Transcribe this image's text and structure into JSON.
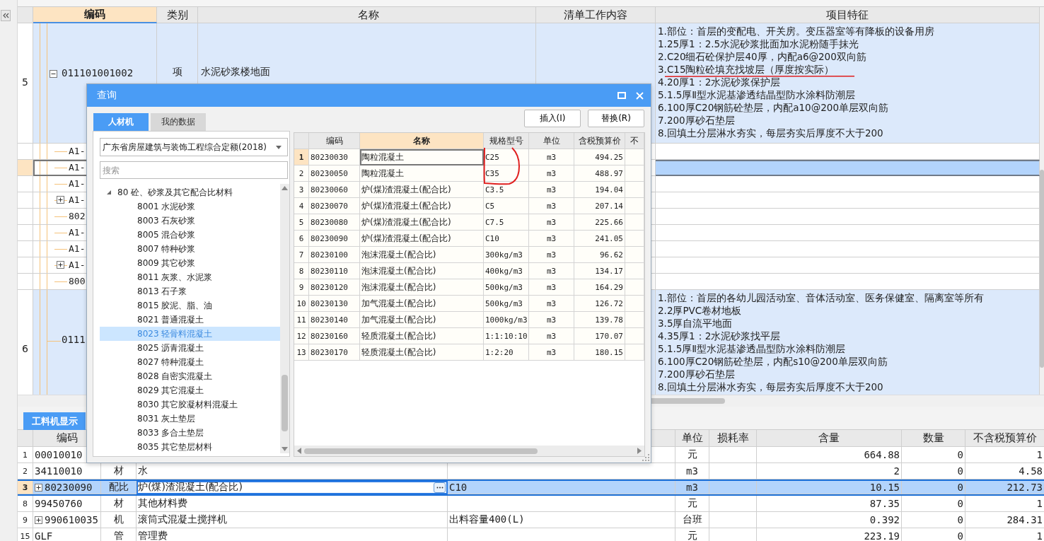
{
  "grid": {
    "columns": [
      "编码",
      "类别",
      "名称",
      "清单工作内容",
      "项目特征"
    ],
    "rows": [
      {
        "kind": "item",
        "num": "5",
        "code": "011101001002",
        "expanded": true,
        "type": "项",
        "name": "水泥砂浆楼地面",
        "features": [
          "1.部位：首层的变配电、开关房。变压器室等有降板的设备用房",
          "1.25厚1：2.5水泥砂浆批面加水泥粉随手抹光",
          "2.C20细石砼保护层40厚，内配a6@200双向筋",
          "3.C15陶粒砼填充找坡层（厚度按实际）",
          "4.20厚1：2水泥砂浆保护层",
          "5.1.5厚Ⅱ型水泥基渗透结晶型防水涂料防潮层",
          "6.100厚C20钢筋砼垫层，内配a10@200单层双向筋",
          "7.200厚砂石垫层",
          "8.回填土分层淋水夯实，每层夯实后厚度不大于200"
        ]
      },
      {
        "kind": "sub",
        "code": "A1-",
        "selected": false
      },
      {
        "kind": "sub",
        "code": "A1-",
        "selected": true
      },
      {
        "kind": "sub",
        "code": "A1-",
        "selected": false
      },
      {
        "kind": "sub",
        "code": "A1-",
        "expanded": false,
        "selected": false
      },
      {
        "kind": "sub",
        "code": "802",
        "selected": false
      },
      {
        "kind": "sub",
        "code": "A1-",
        "selected": false
      },
      {
        "kind": "sub",
        "code": "A1-",
        "selected": false
      },
      {
        "kind": "sub",
        "code": "A1-",
        "expanded": false,
        "selected": false
      },
      {
        "kind": "sub",
        "code": "800",
        "selected": false
      },
      {
        "kind": "item",
        "num": "6",
        "code": "0111",
        "features": [
          "1.部位：首层的各幼儿园活动室、音体活动室、医务保健室、隔离室等所有",
          "2.2厚PVC卷材地板",
          "3.5厚自流平地面",
          "4.35厚1：2水泥砂浆找平层",
          "5.1.5厚Ⅱ型水泥基渗透晶型防水涂料防潮层",
          "6.100厚C20钢筋砼垫层，内配s10@200单层双向筋",
          "7.200厚砂石垫层",
          "8.回填土分层淋水夯实，每层夯实后厚度不大于200"
        ]
      }
    ]
  },
  "materials": {
    "tab": "工料机显示",
    "columns": {
      "code": "编码",
      "unit": "单位",
      "loss": "损耗率",
      "content": "含量",
      "qty": "数量",
      "price": "不含税预算价"
    },
    "rows": [
      {
        "num": "1",
        "code": "00010010",
        "unit": "元",
        "content": "664.88",
        "qty": "0",
        "price": "1",
        "selected": false
      },
      {
        "num": "2",
        "code": "34110010",
        "type": "材",
        "name": "水",
        "unit": "m3",
        "content": "2",
        "qty": "0",
        "price": "4.58",
        "selected": false
      },
      {
        "num": "3",
        "code": "80230090",
        "expanded": false,
        "type": "配比",
        "name": "炉(煤)渣混凝土(配合比)",
        "spec": "C10",
        "unit": "m3",
        "content": "10.15",
        "qty": "0",
        "price": "212.73",
        "selected": true
      },
      {
        "num": "8",
        "code": "99450760",
        "type": "材",
        "name": "其他材料费",
        "unit": "元",
        "content": "87.35",
        "qty": "0",
        "price": "1",
        "selected": false
      },
      {
        "num": "9",
        "code": "990610035",
        "expanded": false,
        "type": "机",
        "name": "滚筒式混凝土搅拌机",
        "spec": "出料容量400(L)",
        "unit": "台班",
        "content": "0.392",
        "qty": "0",
        "price": "284.31",
        "selected": false
      },
      {
        "num": "15",
        "code": "GLF",
        "type": "管",
        "name": "管理费",
        "unit": "元",
        "content": "223.19",
        "qty": "0",
        "price": "1",
        "selected": false
      }
    ]
  },
  "dialog": {
    "title": "查询",
    "tabs": [
      {
        "label": "人材机",
        "selected": true
      },
      {
        "label": "我的数据",
        "selected": false
      }
    ],
    "buttons": [
      "插入(I)",
      "替换(R)"
    ],
    "library": "广东省房屋建筑与装饰工程综合定额(2018)",
    "search": {
      "placeholder": "搜索"
    },
    "tree": [
      {
        "label": "80 砼、砂浆及其它配合比材料",
        "expanded": true,
        "children": [
          {
            "label": "8001 水泥砂浆",
            "selected": false
          },
          {
            "label": "8003 石灰砂浆",
            "selected": false
          },
          {
            "label": "8005 混合砂浆",
            "selected": false
          },
          {
            "label": "8007 特种砂浆",
            "selected": false
          },
          {
            "label": "8009 其它砂浆",
            "selected": false
          },
          {
            "label": "8011 灰浆、水泥浆",
            "selected": false
          },
          {
            "label": "8013 石子浆",
            "selected": false
          },
          {
            "label": "8015 胶泥、脂、油",
            "selected": false
          },
          {
            "label": "8021 普通混凝土",
            "selected": false
          },
          {
            "label": "8023 轻骨料混凝土",
            "selected": true
          },
          {
            "label": "8025 沥青混凝土",
            "selected": false
          },
          {
            "label": "8027 特种混凝土",
            "selected": false
          },
          {
            "label": "8028 自密实混凝土",
            "selected": false
          },
          {
            "label": "8029 其它混凝土",
            "selected": false
          },
          {
            "label": "8030 其它胶凝材料混凝土",
            "selected": false
          },
          {
            "label": "8031 灰土垫层",
            "selected": false
          },
          {
            "label": "8033 多合土垫层",
            "selected": false
          },
          {
            "label": "8035 其它垫层材料",
            "selected": false
          }
        ]
      }
    ],
    "table": {
      "columns": [
        "编码",
        "名称",
        "规格型号",
        "单位",
        "含税预算价",
        "不"
      ],
      "rows": [
        {
          "num": "1",
          "code": "80230030",
          "name": "陶粒混凝土",
          "spec": "C25",
          "unit": "m3",
          "price": "494.25",
          "selected": true
        },
        {
          "num": "2",
          "code": "80230050",
          "name": "陶粒混凝土",
          "spec": "C35",
          "unit": "m3",
          "price": "488.97",
          "selected": false
        },
        {
          "num": "3",
          "code": "80230060",
          "name": "炉(煤)渣混凝土(配合比)",
          "spec": "C3.5",
          "unit": "m3",
          "price": "194.04",
          "selected": false
        },
        {
          "num": "4",
          "code": "80230070",
          "name": "炉(煤)渣混凝土(配合比)",
          "spec": "C5",
          "unit": "m3",
          "price": "207.14",
          "selected": false
        },
        {
          "num": "5",
          "code": "80230080",
          "name": "炉(煤)渣混凝土(配合比)",
          "spec": "C7.5",
          "unit": "m3",
          "price": "225.66",
          "selected": false
        },
        {
          "num": "6",
          "code": "80230090",
          "name": "炉(煤)渣混凝土(配合比)",
          "spec": "C10",
          "unit": "m3",
          "price": "241.05",
          "selected": false
        },
        {
          "num": "7",
          "code": "80230100",
          "name": "泡沫混凝土(配合比)",
          "spec": "300kg/m3",
          "unit": "m3",
          "price": "96.62",
          "selected": false
        },
        {
          "num": "8",
          "code": "80230110",
          "name": "泡沫混凝土(配合比)",
          "spec": "400kg/m3",
          "unit": "m3",
          "price": "134.17",
          "selected": false
        },
        {
          "num": "9",
          "code": "80230120",
          "name": "泡沫混凝土(配合比)",
          "spec": "500kg/m3",
          "unit": "m3",
          "price": "164.29",
          "selected": false
        },
        {
          "num": "10",
          "code": "80230130",
          "name": "加气混凝土(配合比)",
          "spec": "500kg/m3",
          "unit": "m3",
          "price": "126.72",
          "selected": false
        },
        {
          "num": "11",
          "code": "80230140",
          "name": "加气混凝土(配合比)",
          "spec": "1000kg/m3",
          "unit": "m3",
          "price": "139.78",
          "selected": false
        },
        {
          "num": "12",
          "code": "80230160",
          "name": "轻质混凝土(配合比)",
          "spec": "1:1:10:10",
          "unit": "m3",
          "price": "170.07",
          "selected": false
        },
        {
          "num": "13",
          "code": "80230170",
          "name": "轻质混凝土(配合比)",
          "spec": "1:2:20",
          "unit": "m3",
          "price": "180.15",
          "selected": false
        }
      ]
    }
  }
}
